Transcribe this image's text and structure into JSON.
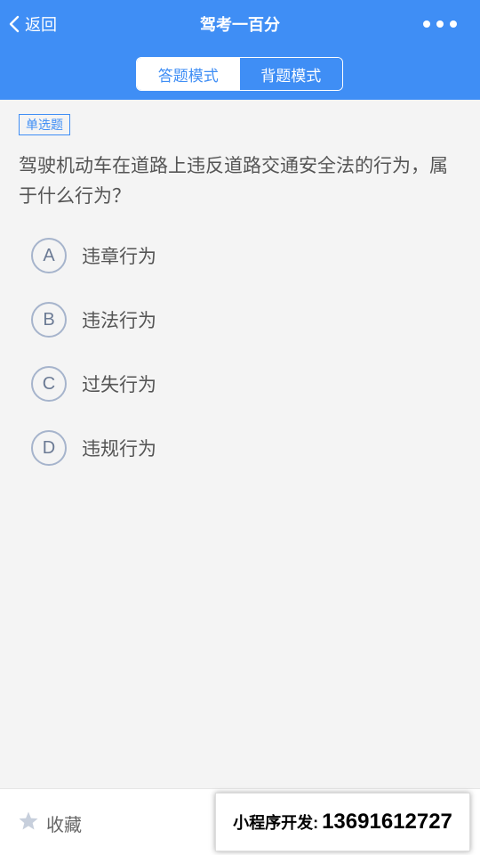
{
  "colors": {
    "primary": "#3f8ef5",
    "background": "#f4f4f4",
    "text": "#555555",
    "option_border": "#a6b4cc",
    "star": "#c7cfdc"
  },
  "header": {
    "back_label": "返回",
    "back_icon": "chevron-left-icon",
    "title": "驾考一百分",
    "more_icon": "more-dots-icon"
  },
  "modes": {
    "items": [
      {
        "label": "答题模式",
        "active": true
      },
      {
        "label": "背题模式",
        "active": false
      }
    ]
  },
  "question": {
    "type_badge": "单选题",
    "text": "驾驶机动车在道路上违反道路交通安全法的行为，属于什么行为？",
    "options": [
      {
        "letter": "A",
        "text": "违章行为"
      },
      {
        "letter": "B",
        "text": "违法行为"
      },
      {
        "letter": "C",
        "text": "过失行为"
      },
      {
        "letter": "D",
        "text": "违规行为"
      }
    ]
  },
  "bottom": {
    "favorite_label": "收藏",
    "favorite_icon": "star-icon",
    "banner_prefix": "小程序开发:",
    "banner_phone": "13691612727"
  }
}
